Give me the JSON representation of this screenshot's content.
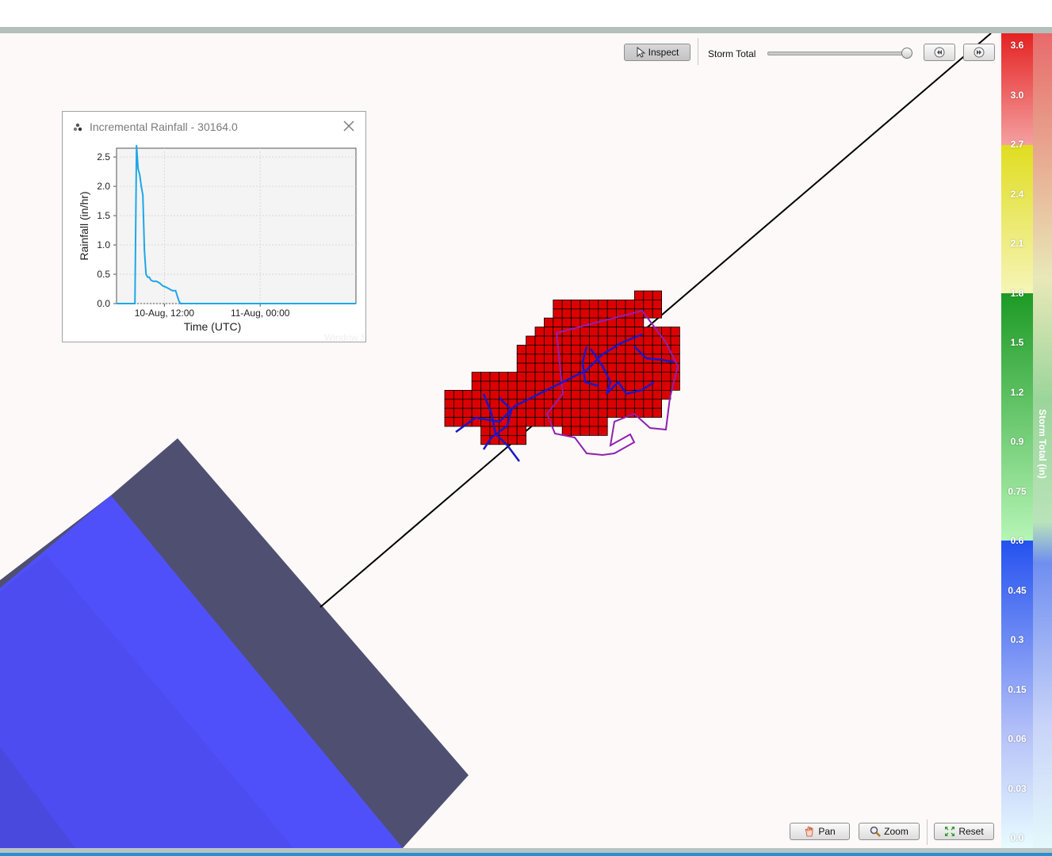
{
  "toolbar": {
    "inspect_label": "Inspect",
    "layer_label": "Storm Total",
    "slider_value": 1.0
  },
  "popup": {
    "title": "Incremental Rainfall - 30164.0",
    "watermark": "Window Snip"
  },
  "chart_data": {
    "type": "line",
    "ylabel": "Rainfall (in/hr)",
    "xlabel": "Time (UTC)",
    "ylim": [
      0,
      2.65
    ],
    "yticks": [
      "0.0",
      "0.5",
      "1.0",
      "1.5",
      "2.0",
      "2.5"
    ],
    "xticks": [
      "10-Aug, 12:00",
      "11-Aug, 00:00"
    ],
    "grid": true,
    "series_color": "#1ea7e6",
    "x_hours": [
      0,
      2.3,
      2.5,
      2.7,
      2.9,
      3.1,
      3.3,
      3.5,
      3.7,
      3.9,
      4.1,
      4.3,
      4.6,
      5.0,
      5.4,
      5.8,
      6.2,
      6.6,
      7.0,
      7.4,
      7.8,
      8.0,
      8.2,
      30
    ],
    "values": [
      0,
      0,
      2.7,
      2.3,
      2.2,
      2.0,
      1.85,
      0.9,
      0.5,
      0.45,
      0.45,
      0.4,
      0.38,
      0.38,
      0.35,
      0.3,
      0.28,
      0.25,
      0.22,
      0.22,
      0.05,
      0.0,
      0.0,
      0.0
    ],
    "x_min_hours": 0,
    "x_max_hours": 30,
    "xtick_hours": [
      6,
      18
    ]
  },
  "legend": {
    "title": "Storm Total (in)",
    "ticks": [
      "3.6",
      "3.0",
      "2.7",
      "2.4",
      "2.1",
      "1.8",
      "1.5",
      "1.2",
      "0.9",
      "0.75",
      "0.6",
      "0.45",
      "0.3",
      "0.15",
      "0.06",
      "0.03",
      "0.0"
    ],
    "colors": [
      "#e52222",
      "#f5a0a0",
      "#e0dd20",
      "#f6f5b8",
      "#1d9a25",
      "#b6f5b6",
      "#2452f0",
      "#b8c4f8",
      "#e8fbff"
    ]
  },
  "bottom_toolbar": {
    "pan_label": "Pan",
    "zoom_label": "Zoom",
    "reset_label": "Reset"
  },
  "colors": {
    "rain_cell": "#dd0000",
    "river": "#1010c8",
    "boundary": "#9020b0",
    "radar_dark": "#4f4f72",
    "radar_blue": "#4b4bff"
  }
}
